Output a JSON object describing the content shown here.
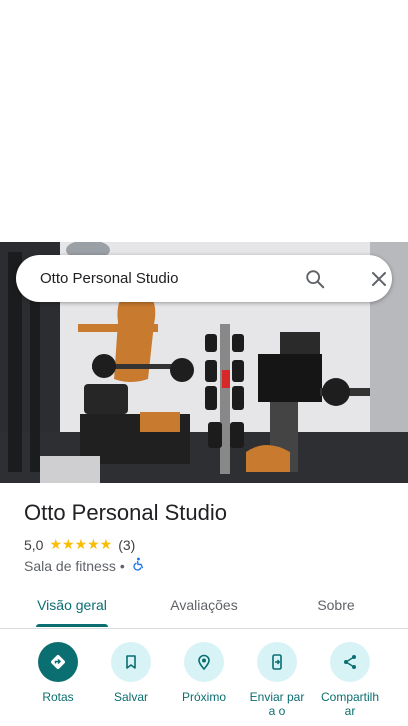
{
  "search": {
    "query": "Otto Personal Studio"
  },
  "place": {
    "name": "Otto Personal Studio",
    "rating": "5,0",
    "stars": "★★★★★",
    "review_count": "(3)",
    "category": "Sala de fitness",
    "separator": "•"
  },
  "tabs": [
    {
      "label": "Visão geral",
      "active": true
    },
    {
      "label": "Avaliações",
      "active": false
    },
    {
      "label": "Sobre",
      "active": false
    }
  ],
  "actions": [
    {
      "label": "Rotas",
      "icon": "directions-icon"
    },
    {
      "label": "Salvar",
      "icon": "bookmark-icon"
    },
    {
      "label": "Próximo",
      "icon": "nearby-icon"
    },
    {
      "label": "Enviar para o",
      "icon": "send-to-phone-icon"
    },
    {
      "label": "Compartilhar",
      "icon": "share-icon"
    }
  ],
  "colors": {
    "accent": "#0b6e70",
    "accent_light": "#d7f3f6",
    "star": "#fbbc04"
  }
}
